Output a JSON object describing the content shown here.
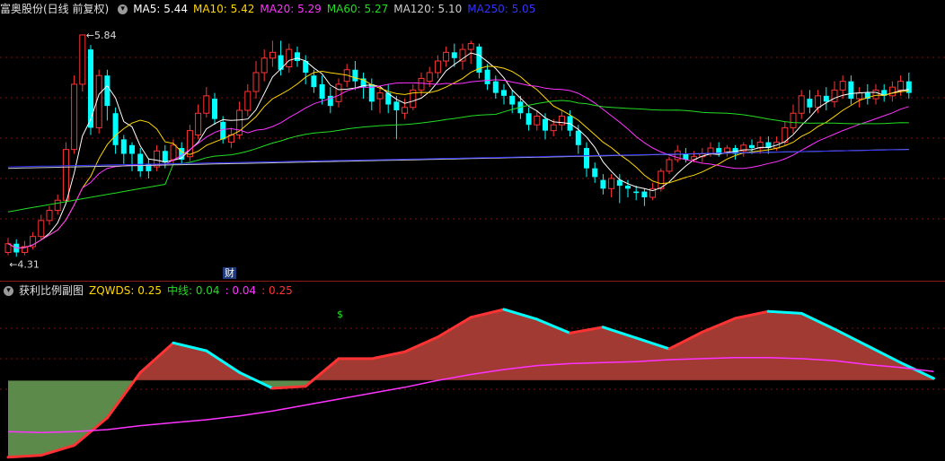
{
  "stock": {
    "name": "富奥股份(日线 前复权)"
  },
  "ma_legend": [
    {
      "label": "MA5: 5.44",
      "color": "#ffffff"
    },
    {
      "label": "MA10: 5.42",
      "color": "#ffd700"
    },
    {
      "label": "MA20: 5.29",
      "color": "#ff33ff"
    },
    {
      "label": "MA60: 5.27",
      "color": "#22dd22"
    },
    {
      "label": "MA120: 5.10",
      "color": "#cccccc"
    },
    {
      "label": "MA250: 5.05",
      "color": "#3333ff"
    }
  ],
  "annotations": {
    "high_label": "5.84",
    "low_label": "4.31",
    "event_label": "财",
    "signal_label": "$"
  },
  "indicator": {
    "name": "获利比例副图",
    "legend": [
      {
        "label": "ZQWDS: 0.25",
        "color": "#ffd700"
      },
      {
        "label": "中线: 0.04",
        "color": "#22dd22"
      },
      {
        "label": ": 0.04",
        "color": "#ff33ff"
      },
      {
        "label": ": 0.25",
        "color": "#ff3333"
      }
    ]
  },
  "colors": {
    "up": "#ff3333",
    "down": "#00ffff",
    "grid": "#7a1010",
    "ma5": "#ffffff",
    "ma10": "#ffd700",
    "ma20": "#ff33ff",
    "ma60": "#22dd22",
    "ma120": "#cccccc",
    "ma250": "#3333ff",
    "fill_pos": "#a03a33",
    "fill_neg": "#5b8a4a"
  },
  "chart_data": [
    {
      "type": "candlestick",
      "ylim": [
        4.25,
        5.92
      ],
      "candles": [
        [
          4.34,
          4.4,
          4.44,
          4.32
        ],
        [
          4.4,
          4.34,
          4.43,
          4.31
        ],
        [
          4.34,
          4.38,
          4.42,
          4.32
        ],
        [
          4.38,
          4.45,
          4.48,
          4.36
        ],
        [
          4.45,
          4.56,
          4.6,
          4.43
        ],
        [
          4.56,
          4.63,
          4.66,
          4.53
        ],
        [
          4.63,
          4.7,
          4.74,
          4.6
        ],
        [
          4.7,
          5.05,
          5.1,
          4.68
        ],
        [
          5.05,
          5.5,
          5.56,
          5.02
        ],
        [
          5.5,
          5.84,
          5.84,
          5.45
        ],
        [
          5.74,
          5.2,
          5.77,
          5.15
        ],
        [
          5.2,
          5.56,
          5.6,
          5.16
        ],
        [
          5.56,
          5.35,
          5.6,
          5.25
        ],
        [
          5.3,
          5.08,
          5.34,
          5.02
        ],
        [
          5.12,
          5.02,
          5.15,
          4.95
        ],
        [
          5.08,
          5.02,
          5.1,
          4.9
        ],
        [
          5.02,
          4.9,
          5.06,
          4.86
        ],
        [
          4.95,
          4.9,
          4.99,
          4.85
        ],
        [
          4.93,
          5.04,
          5.08,
          4.9
        ],
        [
          5.04,
          4.96,
          5.08,
          4.92
        ],
        [
          4.98,
          5.08,
          5.12,
          4.95
        ],
        [
          5.06,
          4.98,
          5.1,
          4.95
        ],
        [
          5.0,
          5.18,
          5.22,
          4.97
        ],
        [
          5.15,
          5.3,
          5.36,
          5.12
        ],
        [
          5.3,
          5.42,
          5.48,
          5.27
        ],
        [
          5.4,
          5.26,
          5.44,
          5.22
        ],
        [
          5.24,
          5.12,
          5.28,
          5.09
        ],
        [
          5.1,
          5.15,
          5.2,
          5.06
        ],
        [
          5.15,
          5.32,
          5.38,
          5.12
        ],
        [
          5.32,
          5.45,
          5.5,
          5.28
        ],
        [
          5.45,
          5.58,
          5.66,
          5.4
        ],
        [
          5.58,
          5.68,
          5.74,
          5.52
        ],
        [
          5.68,
          5.72,
          5.8,
          5.62
        ],
        [
          5.7,
          5.6,
          5.8,
          5.56
        ],
        [
          5.62,
          5.74,
          5.78,
          5.58
        ],
        [
          5.72,
          5.66,
          5.76,
          5.62
        ],
        [
          5.66,
          5.58,
          5.7,
          5.5
        ],
        [
          5.56,
          5.48,
          5.6,
          5.44
        ],
        [
          5.5,
          5.4,
          5.56,
          5.36
        ],
        [
          5.42,
          5.35,
          5.48,
          5.3
        ],
        [
          5.38,
          5.5,
          5.54,
          5.34
        ],
        [
          5.52,
          5.6,
          5.64,
          5.48
        ],
        [
          5.6,
          5.52,
          5.66,
          5.46
        ],
        [
          5.54,
          5.48,
          5.58,
          5.4
        ],
        [
          5.5,
          5.38,
          5.54,
          5.32
        ],
        [
          5.4,
          5.44,
          5.48,
          5.3
        ],
        [
          5.44,
          5.36,
          5.5,
          5.3
        ],
        [
          5.38,
          5.32,
          5.42,
          5.12
        ],
        [
          5.3,
          5.34,
          5.4,
          5.26
        ],
        [
          5.34,
          5.46,
          5.5,
          5.32
        ],
        [
          5.46,
          5.54,
          5.58,
          5.42
        ],
        [
          5.52,
          5.58,
          5.62,
          5.48
        ],
        [
          5.58,
          5.66,
          5.7,
          5.54
        ],
        [
          5.66,
          5.72,
          5.76,
          5.62
        ],
        [
          5.72,
          5.68,
          5.78,
          5.62
        ],
        [
          5.66,
          5.74,
          5.78,
          5.6
        ],
        [
          5.74,
          5.78,
          5.8,
          5.64
        ],
        [
          5.76,
          5.58,
          5.78,
          5.54
        ],
        [
          5.6,
          5.5,
          5.64,
          5.46
        ],
        [
          5.52,
          5.44,
          5.56,
          5.4
        ],
        [
          5.46,
          5.42,
          5.5,
          5.36
        ],
        [
          5.42,
          5.36,
          5.46,
          5.3
        ],
        [
          5.38,
          5.3,
          5.42,
          5.26
        ],
        [
          5.3,
          5.22,
          5.34,
          5.18
        ],
        [
          5.22,
          5.28,
          5.32,
          5.18
        ],
        [
          5.26,
          5.18,
          5.3,
          5.12
        ],
        [
          5.18,
          5.22,
          5.26,
          5.14
        ],
        [
          5.22,
          5.28,
          5.32,
          5.18
        ],
        [
          5.28,
          5.18,
          5.32,
          5.14
        ],
        [
          5.18,
          5.08,
          5.22,
          5.02
        ],
        [
          5.06,
          4.92,
          5.1,
          4.86
        ],
        [
          4.92,
          4.86,
          4.96,
          4.82
        ],
        [
          4.84,
          4.78,
          4.88,
          4.74
        ],
        [
          4.78,
          4.85,
          4.88,
          4.72
        ],
        [
          4.84,
          4.8,
          4.88,
          4.68
        ],
        [
          4.8,
          4.78,
          4.84,
          4.72
        ],
        [
          4.76,
          4.75,
          4.8,
          4.7
        ],
        [
          4.76,
          4.72,
          4.78,
          4.66
        ],
        [
          4.72,
          4.78,
          4.82,
          4.7
        ],
        [
          4.78,
          4.9,
          4.92,
          4.76
        ],
        [
          4.9,
          4.98,
          5.0,
          4.88
        ],
        [
          4.98,
          5.04,
          5.08,
          4.96
        ],
        [
          5.02,
          4.98,
          5.06,
          4.96
        ],
        [
          4.98,
          5.0,
          5.04,
          4.96
        ],
        [
          5.0,
          5.02,
          5.06,
          4.96
        ],
        [
          5.02,
          5.06,
          5.1,
          5.0
        ],
        [
          5.06,
          5.02,
          5.1,
          5.0
        ],
        [
          5.03,
          5.06,
          5.08,
          5.0
        ],
        [
          5.06,
          5.02,
          5.08,
          4.98
        ],
        [
          5.04,
          5.08,
          5.1,
          5.0
        ],
        [
          5.08,
          5.06,
          5.12,
          5.02
        ],
        [
          5.06,
          5.1,
          5.14,
          5.02
        ],
        [
          5.1,
          5.06,
          5.14,
          5.02
        ],
        [
          5.06,
          5.1,
          5.14,
          5.04
        ],
        [
          5.1,
          5.2,
          5.24,
          5.08
        ],
        [
          5.2,
          5.3,
          5.36,
          5.16
        ],
        [
          5.3,
          5.42,
          5.46,
          5.26
        ],
        [
          5.4,
          5.34,
          5.46,
          5.3
        ],
        [
          5.34,
          5.42,
          5.46,
          5.3
        ],
        [
          5.42,
          5.38,
          5.48,
          5.32
        ],
        [
          5.38,
          5.46,
          5.52,
          5.34
        ],
        [
          5.46,
          5.52,
          5.56,
          5.4
        ],
        [
          5.52,
          5.4,
          5.56,
          5.36
        ],
        [
          5.4,
          5.44,
          5.48,
          5.34
        ],
        [
          5.44,
          5.4,
          5.5,
          5.36
        ],
        [
          5.4,
          5.46,
          5.5,
          5.36
        ],
        [
          5.46,
          5.42,
          5.5,
          5.38
        ],
        [
          5.42,
          5.48,
          5.52,
          5.38
        ],
        [
          5.46,
          5.52,
          5.56,
          5.42
        ],
        [
          5.52,
          5.44,
          5.58,
          5.4
        ]
      ]
    },
    {
      "type": "area",
      "ylim": [
        -0.8,
        0.82
      ],
      "x": [
        0,
        4,
        8,
        12,
        16,
        20,
        24,
        28,
        32,
        36,
        40,
        44,
        48,
        52,
        56,
        60,
        64,
        68,
        72,
        76,
        80,
        84,
        88,
        92,
        96,
        100,
        104,
        108,
        112
      ],
      "series": [
        {
          "name": "ZQWDS",
          "values": [
            -0.78,
            -0.76,
            -0.66,
            -0.38,
            0.08,
            0.38,
            0.3,
            0.08,
            -0.08,
            -0.06,
            0.22,
            0.22,
            0.29,
            0.44,
            0.64,
            0.72,
            0.62,
            0.48,
            0.54,
            0.43,
            0.32,
            0.49,
            0.63,
            0.7,
            0.68,
            0.52,
            0.35,
            0.18,
            0.02
          ]
        },
        {
          "name": "中线",
          "values": [
            -0.52,
            -0.53,
            -0.52,
            -0.5,
            -0.46,
            -0.43,
            -0.4,
            -0.36,
            -0.31,
            -0.25,
            -0.19,
            -0.13,
            -0.07,
            0.0,
            0.06,
            0.11,
            0.15,
            0.17,
            0.18,
            0.19,
            0.21,
            0.22,
            0.23,
            0.23,
            0.22,
            0.2,
            0.16,
            0.13,
            0.09
          ]
        }
      ]
    }
  ]
}
